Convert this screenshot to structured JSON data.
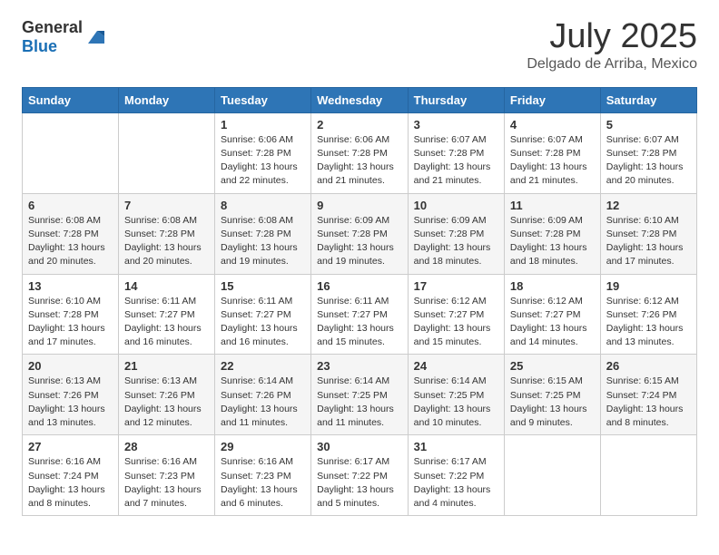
{
  "header": {
    "logo": {
      "general": "General",
      "blue": "Blue"
    },
    "title": "July 2025",
    "location": "Delgado de Arriba, Mexico"
  },
  "days_of_week": [
    "Sunday",
    "Monday",
    "Tuesday",
    "Wednesday",
    "Thursday",
    "Friday",
    "Saturday"
  ],
  "weeks": [
    [
      {
        "day": "",
        "info": ""
      },
      {
        "day": "",
        "info": ""
      },
      {
        "day": "1",
        "info": "Sunrise: 6:06 AM\nSunset: 7:28 PM\nDaylight: 13 hours and 22 minutes."
      },
      {
        "day": "2",
        "info": "Sunrise: 6:06 AM\nSunset: 7:28 PM\nDaylight: 13 hours and 21 minutes."
      },
      {
        "day": "3",
        "info": "Sunrise: 6:07 AM\nSunset: 7:28 PM\nDaylight: 13 hours and 21 minutes."
      },
      {
        "day": "4",
        "info": "Sunrise: 6:07 AM\nSunset: 7:28 PM\nDaylight: 13 hours and 21 minutes."
      },
      {
        "day": "5",
        "info": "Sunrise: 6:07 AM\nSunset: 7:28 PM\nDaylight: 13 hours and 20 minutes."
      }
    ],
    [
      {
        "day": "6",
        "info": "Sunrise: 6:08 AM\nSunset: 7:28 PM\nDaylight: 13 hours and 20 minutes."
      },
      {
        "day": "7",
        "info": "Sunrise: 6:08 AM\nSunset: 7:28 PM\nDaylight: 13 hours and 20 minutes."
      },
      {
        "day": "8",
        "info": "Sunrise: 6:08 AM\nSunset: 7:28 PM\nDaylight: 13 hours and 19 minutes."
      },
      {
        "day": "9",
        "info": "Sunrise: 6:09 AM\nSunset: 7:28 PM\nDaylight: 13 hours and 19 minutes."
      },
      {
        "day": "10",
        "info": "Sunrise: 6:09 AM\nSunset: 7:28 PM\nDaylight: 13 hours and 18 minutes."
      },
      {
        "day": "11",
        "info": "Sunrise: 6:09 AM\nSunset: 7:28 PM\nDaylight: 13 hours and 18 minutes."
      },
      {
        "day": "12",
        "info": "Sunrise: 6:10 AM\nSunset: 7:28 PM\nDaylight: 13 hours and 17 minutes."
      }
    ],
    [
      {
        "day": "13",
        "info": "Sunrise: 6:10 AM\nSunset: 7:28 PM\nDaylight: 13 hours and 17 minutes."
      },
      {
        "day": "14",
        "info": "Sunrise: 6:11 AM\nSunset: 7:27 PM\nDaylight: 13 hours and 16 minutes."
      },
      {
        "day": "15",
        "info": "Sunrise: 6:11 AM\nSunset: 7:27 PM\nDaylight: 13 hours and 16 minutes."
      },
      {
        "day": "16",
        "info": "Sunrise: 6:11 AM\nSunset: 7:27 PM\nDaylight: 13 hours and 15 minutes."
      },
      {
        "day": "17",
        "info": "Sunrise: 6:12 AM\nSunset: 7:27 PM\nDaylight: 13 hours and 15 minutes."
      },
      {
        "day": "18",
        "info": "Sunrise: 6:12 AM\nSunset: 7:27 PM\nDaylight: 13 hours and 14 minutes."
      },
      {
        "day": "19",
        "info": "Sunrise: 6:12 AM\nSunset: 7:26 PM\nDaylight: 13 hours and 13 minutes."
      }
    ],
    [
      {
        "day": "20",
        "info": "Sunrise: 6:13 AM\nSunset: 7:26 PM\nDaylight: 13 hours and 13 minutes."
      },
      {
        "day": "21",
        "info": "Sunrise: 6:13 AM\nSunset: 7:26 PM\nDaylight: 13 hours and 12 minutes."
      },
      {
        "day": "22",
        "info": "Sunrise: 6:14 AM\nSunset: 7:26 PM\nDaylight: 13 hours and 11 minutes."
      },
      {
        "day": "23",
        "info": "Sunrise: 6:14 AM\nSunset: 7:25 PM\nDaylight: 13 hours and 11 minutes."
      },
      {
        "day": "24",
        "info": "Sunrise: 6:14 AM\nSunset: 7:25 PM\nDaylight: 13 hours and 10 minutes."
      },
      {
        "day": "25",
        "info": "Sunrise: 6:15 AM\nSunset: 7:25 PM\nDaylight: 13 hours and 9 minutes."
      },
      {
        "day": "26",
        "info": "Sunrise: 6:15 AM\nSunset: 7:24 PM\nDaylight: 13 hours and 8 minutes."
      }
    ],
    [
      {
        "day": "27",
        "info": "Sunrise: 6:16 AM\nSunset: 7:24 PM\nDaylight: 13 hours and 8 minutes."
      },
      {
        "day": "28",
        "info": "Sunrise: 6:16 AM\nSunset: 7:23 PM\nDaylight: 13 hours and 7 minutes."
      },
      {
        "day": "29",
        "info": "Sunrise: 6:16 AM\nSunset: 7:23 PM\nDaylight: 13 hours and 6 minutes."
      },
      {
        "day": "30",
        "info": "Sunrise: 6:17 AM\nSunset: 7:22 PM\nDaylight: 13 hours and 5 minutes."
      },
      {
        "day": "31",
        "info": "Sunrise: 6:17 AM\nSunset: 7:22 PM\nDaylight: 13 hours and 4 minutes."
      },
      {
        "day": "",
        "info": ""
      },
      {
        "day": "",
        "info": ""
      }
    ]
  ]
}
